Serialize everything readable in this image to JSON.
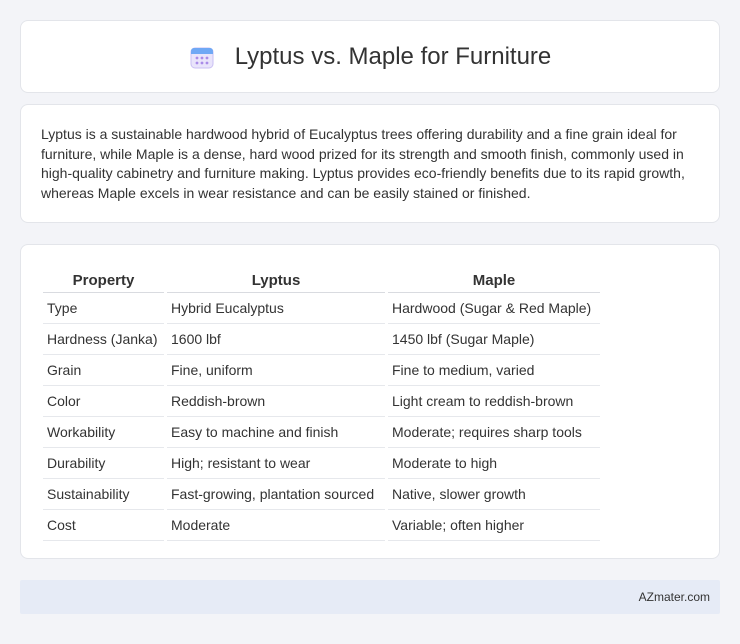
{
  "header": {
    "title": "Lyptus vs. Maple for Furniture",
    "icon": "calendar-icon"
  },
  "intro": {
    "text": "Lyptus is a sustainable hardwood hybrid of Eucalyptus trees offering durability and a fine grain ideal for furniture, while Maple is a dense, hard wood prized for its strength and smooth finish, commonly used in high-quality cabinetry and furniture making. Lyptus provides eco-friendly benefits due to its rapid growth, whereas Maple excels in wear resistance and can be easily stained or finished."
  },
  "table": {
    "headers": [
      "Property",
      "Lyptus",
      "Maple"
    ],
    "rows": [
      [
        "Type",
        "Hybrid Eucalyptus",
        "Hardwood (Sugar & Red Maple)"
      ],
      [
        "Hardness (Janka)",
        "1600 lbf",
        "1450 lbf (Sugar Maple)"
      ],
      [
        "Grain",
        "Fine, uniform",
        "Fine to medium, varied"
      ],
      [
        "Color",
        "Reddish-brown",
        "Light cream to reddish-brown"
      ],
      [
        "Workability",
        "Easy to machine and finish",
        "Moderate; requires sharp tools"
      ],
      [
        "Durability",
        "High; resistant to wear",
        "Moderate to high"
      ],
      [
        "Sustainability",
        "Fast-growing, plantation sourced",
        "Native, slower growth"
      ],
      [
        "Cost",
        "Moderate",
        "Variable; often higher"
      ]
    ]
  },
  "footer": {
    "brand": "AZmater.com"
  }
}
